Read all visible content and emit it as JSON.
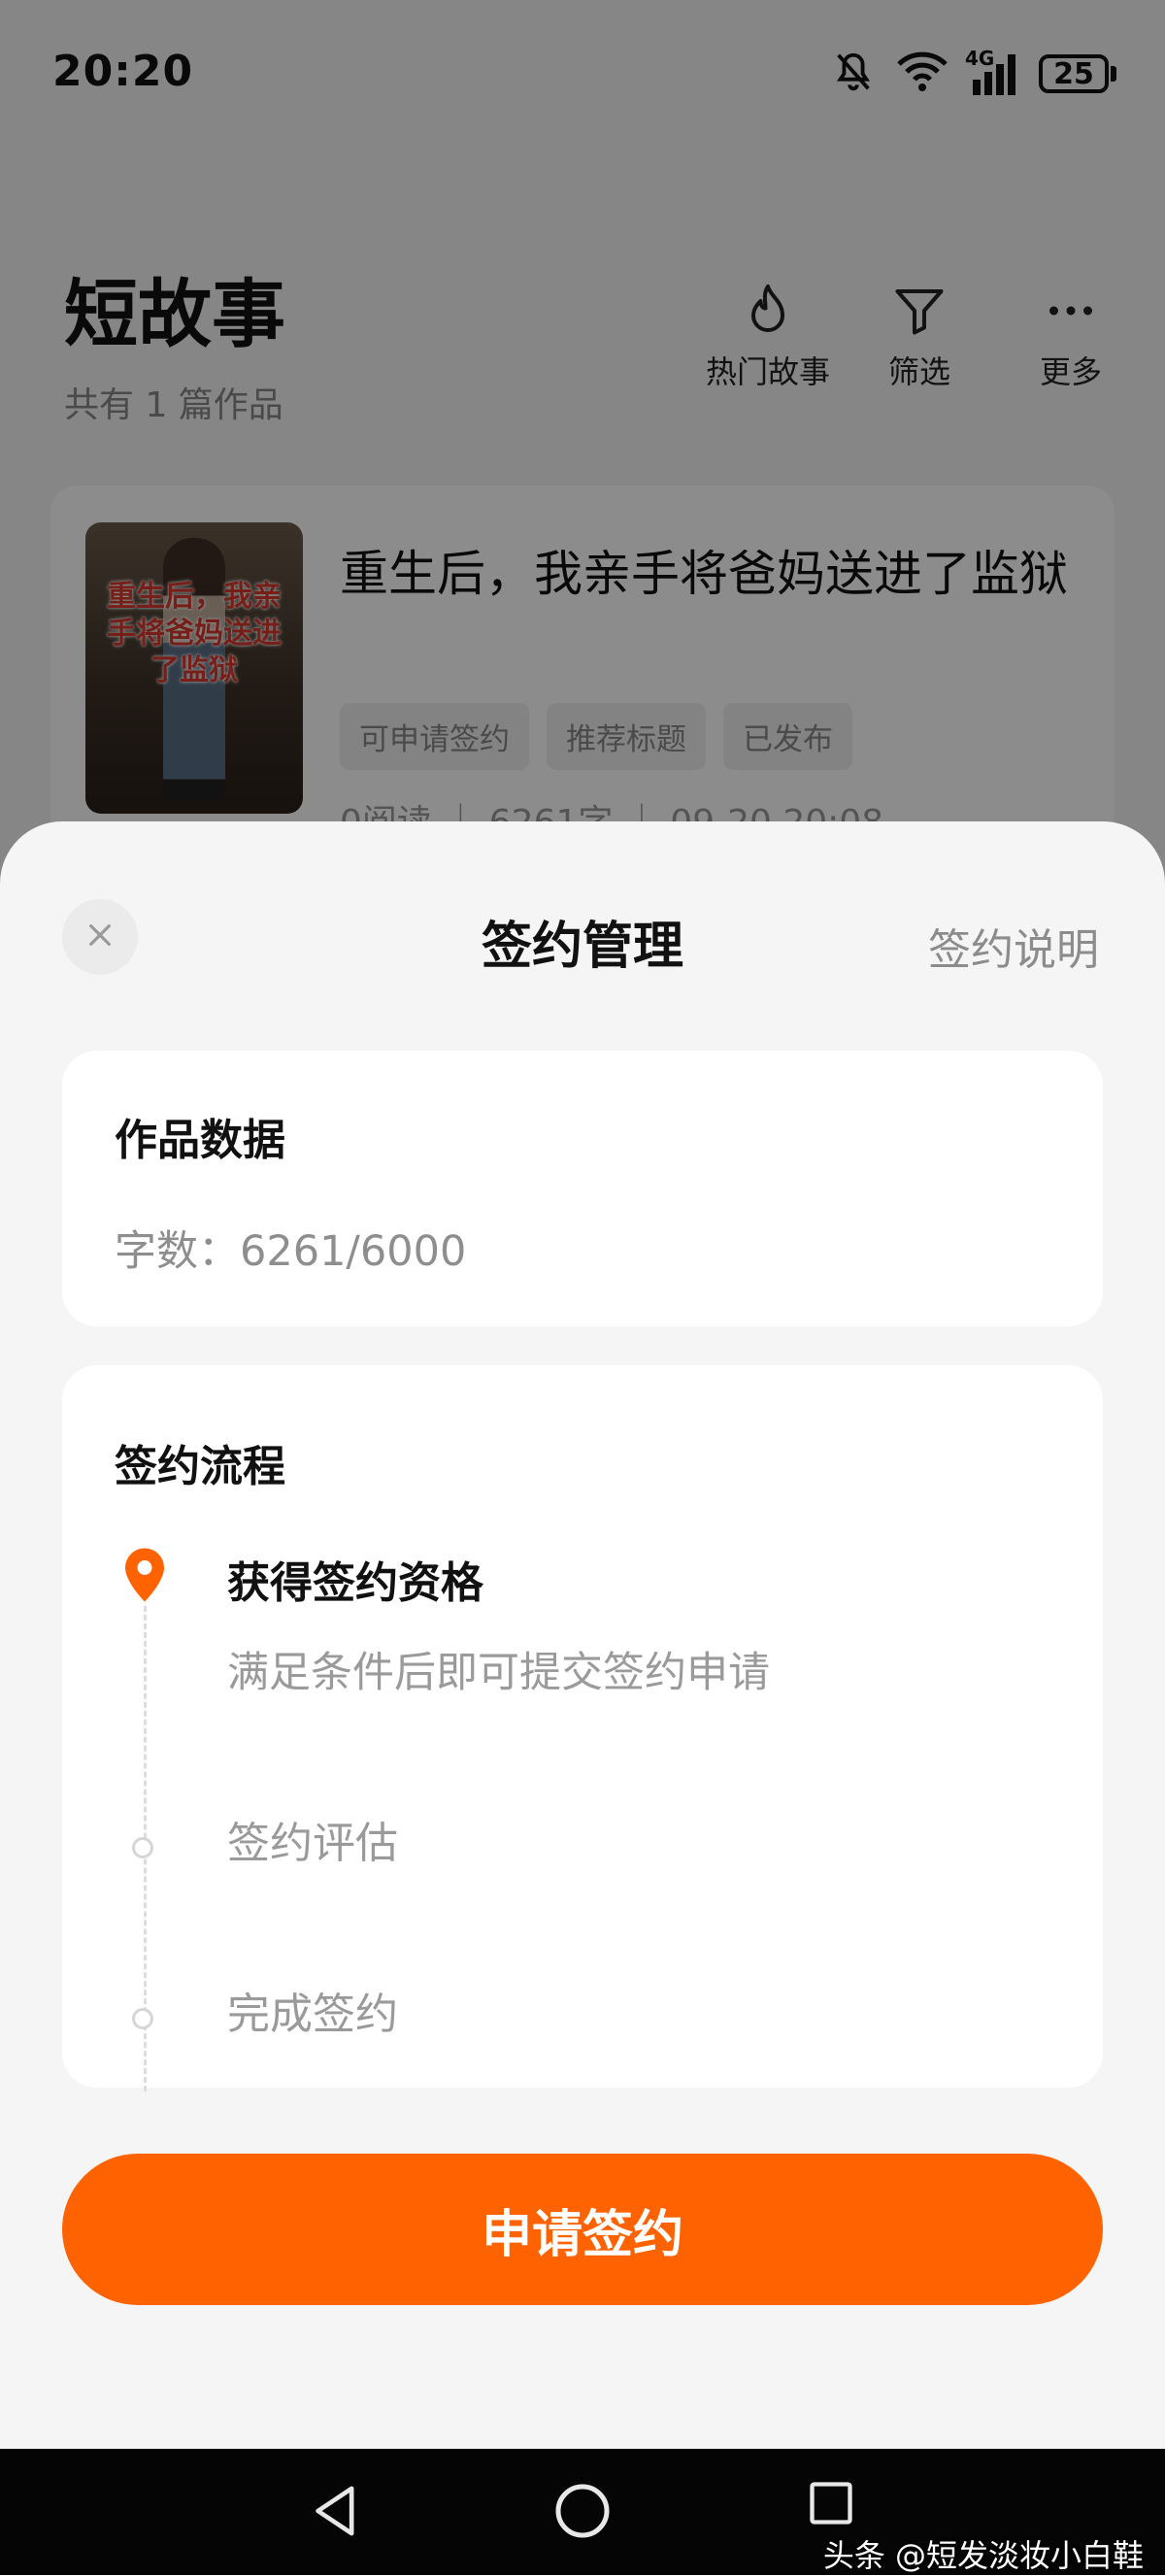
{
  "status_bar": {
    "time": "20:20",
    "network": "4G",
    "battery": "25",
    "icons": [
      "bell-muted-icon",
      "wifi-icon",
      "cellular-signal-icon",
      "battery-icon"
    ]
  },
  "page": {
    "title": "短故事",
    "subtitle": "共有 1 篇作品",
    "actions": [
      {
        "label": "热门故事",
        "icon": "flame-icon"
      },
      {
        "label": "筛选",
        "icon": "filter-icon"
      },
      {
        "label": "更多",
        "icon": "more-icon"
      }
    ]
  },
  "story": {
    "cover_text": "重生后，我亲手将爸妈送进了监狱",
    "title": "重生后，我亲手将爸妈送进了监狱",
    "tags": [
      "可申请签约",
      "推荐标题",
      "已发布"
    ],
    "meta": "0阅读 ｜ 6261字 ｜ 09-20 20:08"
  },
  "sheet": {
    "title": "签约管理",
    "help_link": "签约说明",
    "stats": {
      "heading": "作品数据",
      "word_count": "字数：6261/6000"
    },
    "flow": {
      "heading": "签约流程",
      "steps": [
        {
          "title": "获得签约资格",
          "desc": "满足条件后即可提交签约申请",
          "state": "current"
        },
        {
          "title": "签约评估",
          "state": "pending"
        },
        {
          "title": "完成签约",
          "state": "pending"
        }
      ]
    },
    "apply_button": "申请签约"
  },
  "colors": {
    "accent": "#ff6200",
    "sheet_bg": "#f5f5f5",
    "muted_text": "#9a9a9a"
  },
  "nav": {
    "buttons": [
      "back-icon",
      "home-icon",
      "recents-icon"
    ]
  },
  "watermark": "头条 @短发淡妆小白鞋"
}
